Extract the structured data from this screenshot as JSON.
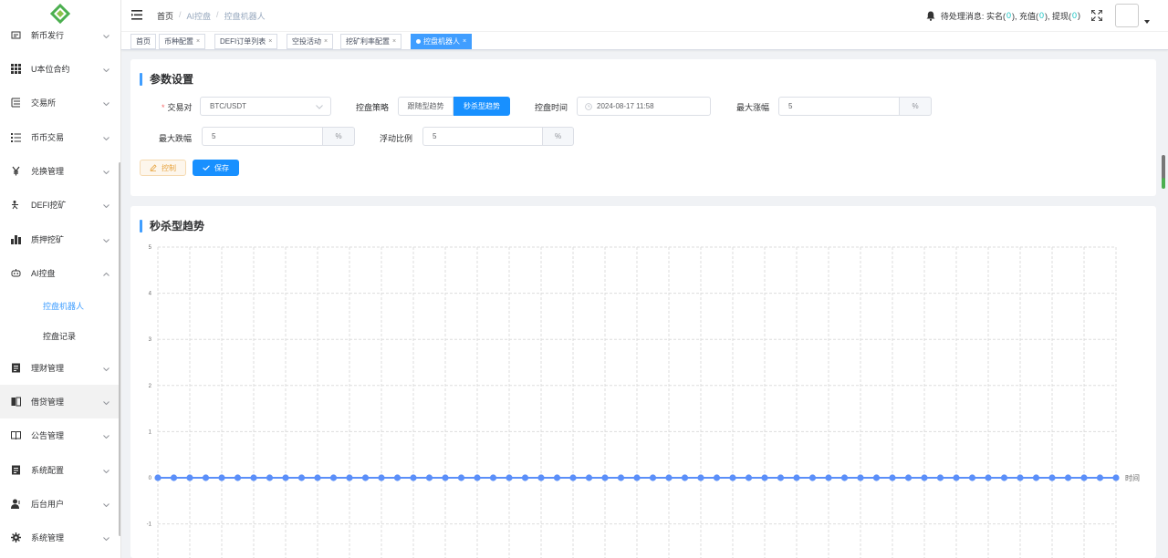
{
  "sidebar": {
    "items": [
      {
        "label": "新币发行",
        "icon": "new-coin-icon"
      },
      {
        "label": "U本位合约",
        "icon": "grid-icon"
      },
      {
        "label": "交易所",
        "icon": "exchange-icon"
      },
      {
        "label": "币币交易",
        "icon": "list-icon"
      },
      {
        "label": "兑换管理",
        "icon": "yen-icon"
      },
      {
        "label": "DEFI挖矿",
        "icon": "defi-icon"
      },
      {
        "label": "质押挖矿",
        "icon": "bar-chart-icon"
      },
      {
        "label": "AI控盘",
        "icon": "robot-icon"
      },
      {
        "label": "理财管理",
        "icon": "finance-icon"
      },
      {
        "label": "借贷管理",
        "icon": "loan-icon"
      },
      {
        "label": "公告管理",
        "icon": "book-icon"
      },
      {
        "label": "系统配置",
        "icon": "config-icon"
      },
      {
        "label": "后台用户",
        "icon": "user-icon"
      },
      {
        "label": "系统管理",
        "icon": "gear-icon"
      }
    ],
    "submenu": [
      {
        "label": "控盘机器人"
      },
      {
        "label": "控盘记录"
      }
    ]
  },
  "header": {
    "breadcrumb": [
      "首页",
      "AI控盘",
      "控盘机器人"
    ],
    "pending_label": "待处理消息:",
    "realname_label": "实名(",
    "realname_count": "0",
    "recharge_label": "),  充值(",
    "recharge_count": "0",
    "withdraw_label": "),  提现(",
    "withdraw_count": "0",
    "close_paren": ")"
  },
  "tags": [
    {
      "label": "首页"
    },
    {
      "label": "币种配置"
    },
    {
      "label": "DEFI订单列表"
    },
    {
      "label": "空投活动"
    },
    {
      "label": "挖矿利率配置"
    },
    {
      "label": "控盘机器人"
    }
  ],
  "params": {
    "title": "参数设置",
    "pair_label": "交易对",
    "pair_value": "BTC/USDT",
    "strategy_label": "控盘策略",
    "strategy_options": [
      "跟随型趋势",
      "秒杀型趋势"
    ],
    "time_label": "控盘时间",
    "time_value": "2024-08-17 11:58",
    "max_rise_label": "最大涨幅",
    "max_rise_value": "5",
    "max_fall_label": "最大跌幅",
    "max_fall_value": "5",
    "float_label": "浮动比例",
    "float_value": "5",
    "percent": "%",
    "control_button": "控制",
    "save_button": "保存"
  },
  "chart_section": {
    "title": "秒杀型趋势"
  },
  "chart_data": {
    "type": "line",
    "xlabel": "时间",
    "ylabel": "",
    "yticks": [
      "5",
      "4",
      "3",
      "2",
      "1",
      "0",
      "-1"
    ],
    "ylim": [
      -1.7,
      5
    ],
    "grid": true,
    "series": [
      {
        "values": [
          0,
          0,
          0,
          0,
          0,
          0,
          0,
          0,
          0,
          0,
          0,
          0,
          0,
          0,
          0,
          0,
          0,
          0,
          0,
          0,
          0,
          0,
          0,
          0,
          0,
          0,
          0,
          0,
          0,
          0,
          0,
          0,
          0,
          0,
          0,
          0,
          0,
          0,
          0,
          0,
          0,
          0,
          0,
          0,
          0,
          0,
          0,
          0,
          0,
          0,
          0,
          0,
          0,
          0,
          0,
          0,
          0,
          0,
          0,
          0,
          0
        ]
      }
    ],
    "color": "#5b8ff9"
  }
}
